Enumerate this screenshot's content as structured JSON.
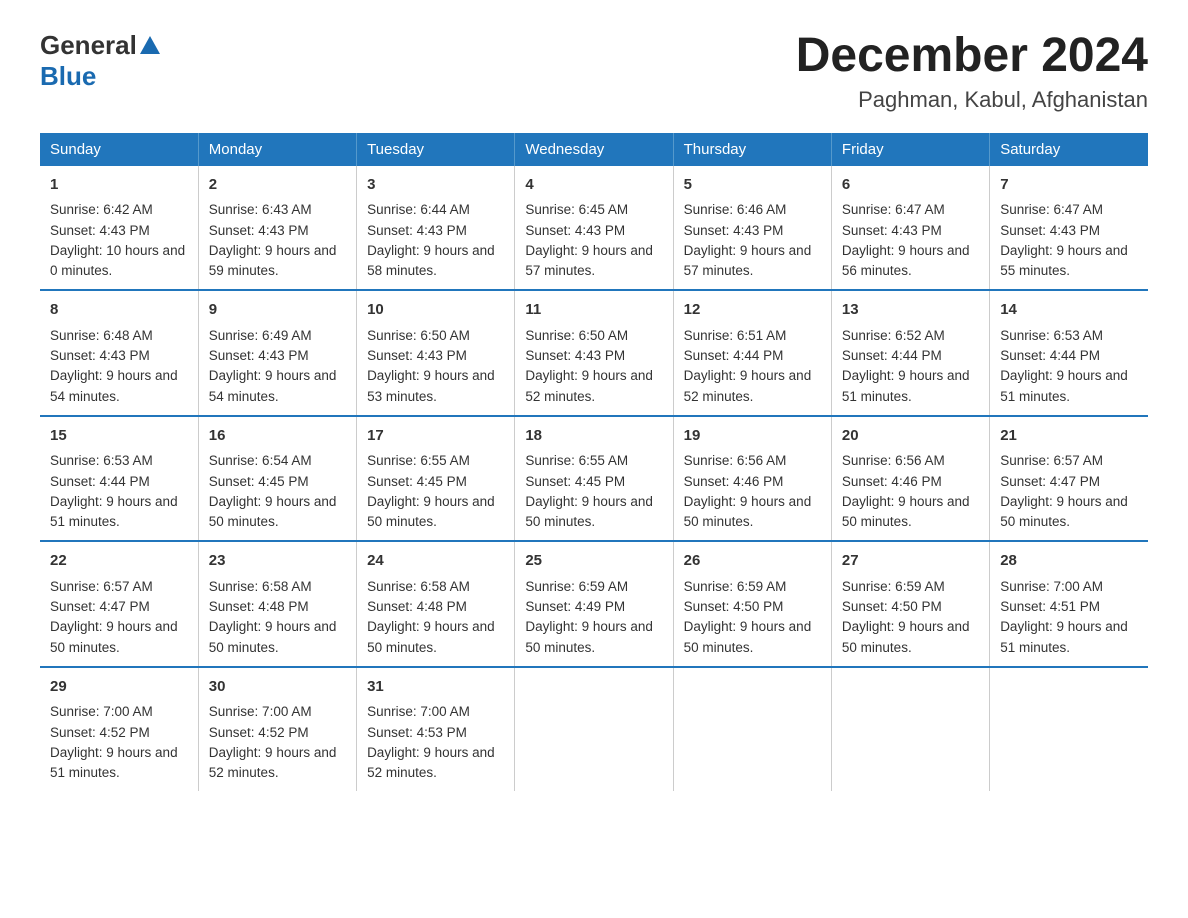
{
  "header": {
    "title": "December 2024",
    "subtitle": "Paghman, Kabul, Afghanistan",
    "logo_general": "General",
    "logo_blue": "Blue"
  },
  "calendar": {
    "days_of_week": [
      "Sunday",
      "Monday",
      "Tuesday",
      "Wednesday",
      "Thursday",
      "Friday",
      "Saturday"
    ],
    "weeks": [
      [
        {
          "day": "1",
          "sunrise": "6:42 AM",
          "sunset": "4:43 PM",
          "daylight": "10 hours and 0 minutes."
        },
        {
          "day": "2",
          "sunrise": "6:43 AM",
          "sunset": "4:43 PM",
          "daylight": "9 hours and 59 minutes."
        },
        {
          "day": "3",
          "sunrise": "6:44 AM",
          "sunset": "4:43 PM",
          "daylight": "9 hours and 58 minutes."
        },
        {
          "day": "4",
          "sunrise": "6:45 AM",
          "sunset": "4:43 PM",
          "daylight": "9 hours and 57 minutes."
        },
        {
          "day": "5",
          "sunrise": "6:46 AM",
          "sunset": "4:43 PM",
          "daylight": "9 hours and 57 minutes."
        },
        {
          "day": "6",
          "sunrise": "6:47 AM",
          "sunset": "4:43 PM",
          "daylight": "9 hours and 56 minutes."
        },
        {
          "day": "7",
          "sunrise": "6:47 AM",
          "sunset": "4:43 PM",
          "daylight": "9 hours and 55 minutes."
        }
      ],
      [
        {
          "day": "8",
          "sunrise": "6:48 AM",
          "sunset": "4:43 PM",
          "daylight": "9 hours and 54 minutes."
        },
        {
          "day": "9",
          "sunrise": "6:49 AM",
          "sunset": "4:43 PM",
          "daylight": "9 hours and 54 minutes."
        },
        {
          "day": "10",
          "sunrise": "6:50 AM",
          "sunset": "4:43 PM",
          "daylight": "9 hours and 53 minutes."
        },
        {
          "day": "11",
          "sunrise": "6:50 AM",
          "sunset": "4:43 PM",
          "daylight": "9 hours and 52 minutes."
        },
        {
          "day": "12",
          "sunrise": "6:51 AM",
          "sunset": "4:44 PM",
          "daylight": "9 hours and 52 minutes."
        },
        {
          "day": "13",
          "sunrise": "6:52 AM",
          "sunset": "4:44 PM",
          "daylight": "9 hours and 51 minutes."
        },
        {
          "day": "14",
          "sunrise": "6:53 AM",
          "sunset": "4:44 PM",
          "daylight": "9 hours and 51 minutes."
        }
      ],
      [
        {
          "day": "15",
          "sunrise": "6:53 AM",
          "sunset": "4:44 PM",
          "daylight": "9 hours and 51 minutes."
        },
        {
          "day": "16",
          "sunrise": "6:54 AM",
          "sunset": "4:45 PM",
          "daylight": "9 hours and 50 minutes."
        },
        {
          "day": "17",
          "sunrise": "6:55 AM",
          "sunset": "4:45 PM",
          "daylight": "9 hours and 50 minutes."
        },
        {
          "day": "18",
          "sunrise": "6:55 AM",
          "sunset": "4:45 PM",
          "daylight": "9 hours and 50 minutes."
        },
        {
          "day": "19",
          "sunrise": "6:56 AM",
          "sunset": "4:46 PM",
          "daylight": "9 hours and 50 minutes."
        },
        {
          "day": "20",
          "sunrise": "6:56 AM",
          "sunset": "4:46 PM",
          "daylight": "9 hours and 50 minutes."
        },
        {
          "day": "21",
          "sunrise": "6:57 AM",
          "sunset": "4:47 PM",
          "daylight": "9 hours and 50 minutes."
        }
      ],
      [
        {
          "day": "22",
          "sunrise": "6:57 AM",
          "sunset": "4:47 PM",
          "daylight": "9 hours and 50 minutes."
        },
        {
          "day": "23",
          "sunrise": "6:58 AM",
          "sunset": "4:48 PM",
          "daylight": "9 hours and 50 minutes."
        },
        {
          "day": "24",
          "sunrise": "6:58 AM",
          "sunset": "4:48 PM",
          "daylight": "9 hours and 50 minutes."
        },
        {
          "day": "25",
          "sunrise": "6:59 AM",
          "sunset": "4:49 PM",
          "daylight": "9 hours and 50 minutes."
        },
        {
          "day": "26",
          "sunrise": "6:59 AM",
          "sunset": "4:50 PM",
          "daylight": "9 hours and 50 minutes."
        },
        {
          "day": "27",
          "sunrise": "6:59 AM",
          "sunset": "4:50 PM",
          "daylight": "9 hours and 50 minutes."
        },
        {
          "day": "28",
          "sunrise": "7:00 AM",
          "sunset": "4:51 PM",
          "daylight": "9 hours and 51 minutes."
        }
      ],
      [
        {
          "day": "29",
          "sunrise": "7:00 AM",
          "sunset": "4:52 PM",
          "daylight": "9 hours and 51 minutes."
        },
        {
          "day": "30",
          "sunrise": "7:00 AM",
          "sunset": "4:52 PM",
          "daylight": "9 hours and 52 minutes."
        },
        {
          "day": "31",
          "sunrise": "7:00 AM",
          "sunset": "4:53 PM",
          "daylight": "9 hours and 52 minutes."
        },
        null,
        null,
        null,
        null
      ]
    ]
  }
}
